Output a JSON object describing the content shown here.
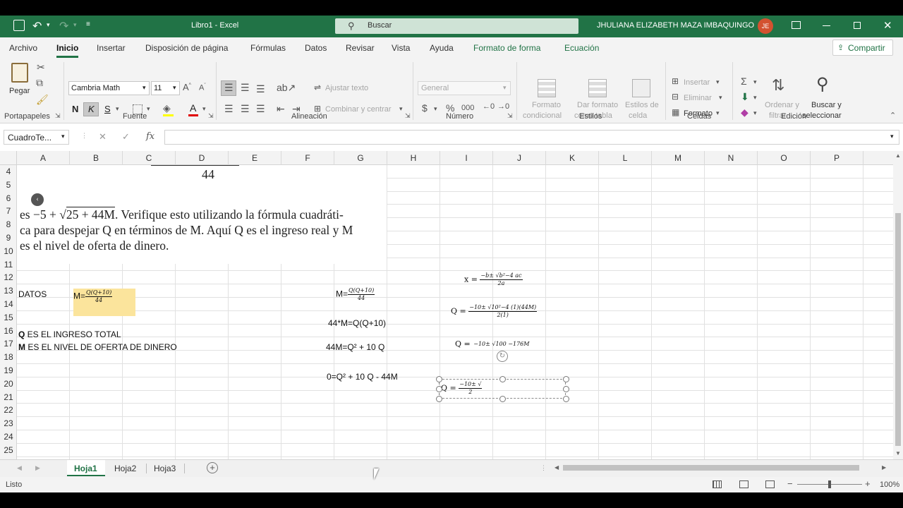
{
  "window": {
    "title": "Libro1  -  Excel",
    "search_placeholder": "Buscar",
    "user": "JHULIANA ELIZABETH MAZA IMBAQUINGO",
    "user_initials": "JE"
  },
  "tabs": [
    "Archivo",
    "Inicio",
    "Insertar",
    "Disposición de página",
    "Fórmulas",
    "Datos",
    "Revisar",
    "Vista",
    "Ayuda",
    "Formato de forma",
    "Ecuación"
  ],
  "share": "Compartir",
  "ribbon": {
    "paste": "Pegar",
    "font_name": "Cambria Math",
    "font_size": "11",
    "bold": "N",
    "italic": "K",
    "underline": "S",
    "wrap_text": "Ajustar texto",
    "merge": "Combinar y centrar",
    "number_format": "General",
    "cond_format_1": "Formato",
    "cond_format_2": "condicional",
    "table_format_1": "Dar formato",
    "table_format_2": "como tabla",
    "cell_styles_1": "Estilos de",
    "cell_styles_2": "celda",
    "insert": "Insertar",
    "delete": "Eliminar",
    "format": "Formato",
    "sort_1": "Ordenar y",
    "sort_2": "filtrar",
    "find_1": "Buscar y",
    "find_2": "seleccionar",
    "groups": {
      "clipboard": "Portapapeles",
      "font": "Fuente",
      "alignment": "Alineación",
      "number": "Número",
      "styles": "Estilos",
      "cells": "Celdas",
      "editing": "Edición"
    }
  },
  "formula_bar": {
    "name_box": "CuadroTe...",
    "fx": "fx",
    "value": ""
  },
  "columns": [
    "A",
    "B",
    "C",
    "D",
    "E",
    "F",
    "G",
    "H",
    "I",
    "J",
    "K",
    "L",
    "M",
    "N",
    "O",
    "P"
  ],
  "rows": [
    "4",
    "5",
    "6",
    "7",
    "8",
    "9",
    "10",
    "11",
    "12",
    "13",
    "14",
    "15",
    "16",
    "17",
    "18",
    "19",
    "20",
    "21",
    "22",
    "23",
    "24",
    "25"
  ],
  "book_text": {
    "top_frac_den": "44",
    "line1_a": "es −5 + ",
    "line1_root": "25 + 44M",
    "line1_b": ". Verifique esto utilizando la fórmula cuadráti-",
    "line2": "ca para despejar Q en términos de M. Aquí Q es el ingreso real y M",
    "line3": "es el nivel de oferta de dinero."
  },
  "cells": {
    "a12": "DATOS",
    "b12_prefix": "M=",
    "b12_num": "Q(Q+10)",
    "b12_den": "44",
    "a15_bold": "Q",
    "a15_rest": " ES EL INGRESO TOTAL",
    "a16_bold": "M",
    "a16_rest": " ES EL NIVEL DE OFERTA DE DINERO",
    "g12_prefix": "M=",
    "g12_num": "Q(Q+10)",
    "g12_den": "44",
    "g14": "44*M=Q(Q+10)",
    "g16": "44M=Q² + 10 Q",
    "g18": "0=Q² + 10 Q - 44M"
  },
  "equations": {
    "eq1_prefix": "x =",
    "eq1_num": "−b± √b²−4 ac",
    "eq1_den": "2a",
    "eq2_prefix": "Q =",
    "eq2_num": "−10± √10²−4 (1)(44M)",
    "eq2_den": "2(1)",
    "eq3_prefix": "Q =",
    "eq3_num": "−10± √100 −176M",
    "eq4_prefix": "Q =",
    "eq4_num": "−10± √",
    "eq4_den": "2"
  },
  "sheets": [
    "Hoja1",
    "Hoja2",
    "Hoja3"
  ],
  "active_sheet": "Hoja1",
  "status": "Listo",
  "zoom": "100%",
  "colors": {
    "excel_green": "#217346",
    "highlight": "#fbe49c",
    "avatar": "#d35230"
  }
}
